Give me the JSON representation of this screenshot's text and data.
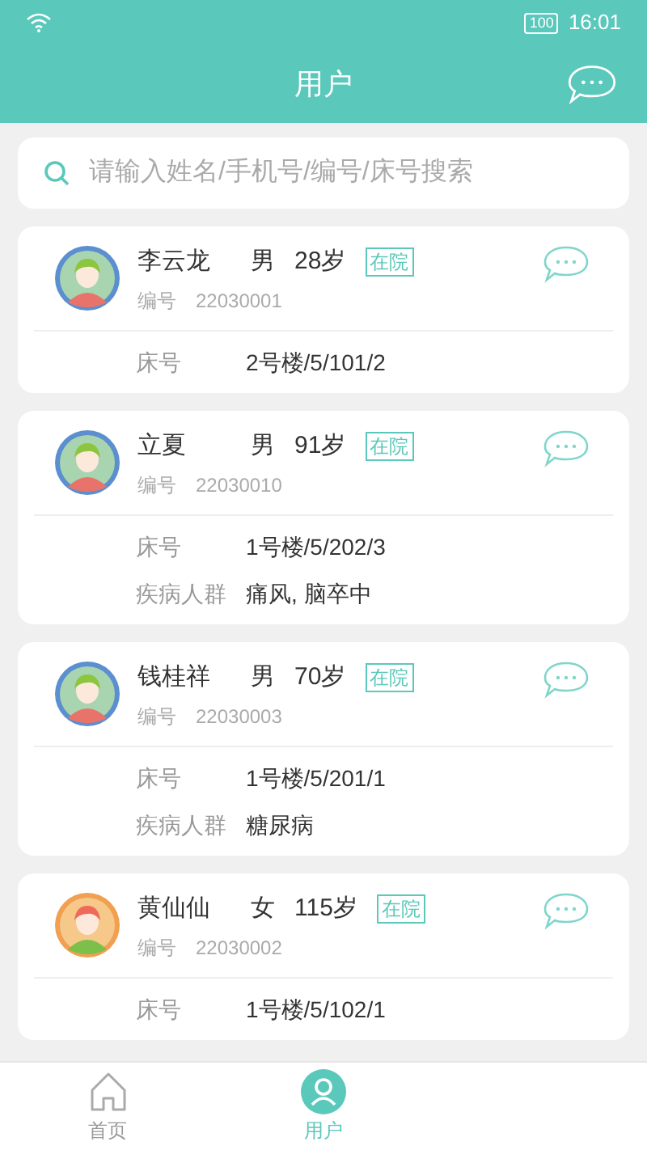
{
  "status_bar": {
    "battery": "100",
    "time": "16:01"
  },
  "header": {
    "title": "用户"
  },
  "search": {
    "placeholder": "请输入姓名/手机号/编号/床号搜索"
  },
  "patients": [
    {
      "kind": "male",
      "name": "李云龙",
      "gender": "男",
      "age": "28岁",
      "status": "在院",
      "id_label": "编号",
      "id": "22030001",
      "details": [
        {
          "label": "床号",
          "value": "2号楼/5/101/2"
        }
      ]
    },
    {
      "kind": "male",
      "name": "立夏",
      "gender": "男",
      "age": "91岁",
      "status": "在院",
      "id_label": "编号",
      "id": "22030010",
      "details": [
        {
          "label": "床号",
          "value": "1号楼/5/202/3"
        },
        {
          "label": "疾病人群",
          "value": "痛风, 脑卒中"
        }
      ]
    },
    {
      "kind": "male",
      "name": "钱桂祥",
      "gender": "男",
      "age": "70岁",
      "status": "在院",
      "id_label": "编号",
      "id": "22030003",
      "details": [
        {
          "label": "床号",
          "value": "1号楼/5/201/1"
        },
        {
          "label": "疾病人群",
          "value": "糖尿病"
        }
      ]
    },
    {
      "kind": "female",
      "name": "黄仙仙",
      "gender": "女",
      "age": "115岁",
      "status": "在院",
      "id_label": "编号",
      "id": "22030002",
      "details": [
        {
          "label": "床号",
          "value": "1号楼/5/102/1"
        }
      ]
    }
  ],
  "tab_bar": [
    {
      "kind": "home",
      "label": "首页",
      "selected": false
    },
    {
      "kind": "user",
      "label": "用户",
      "selected": true
    }
  ]
}
